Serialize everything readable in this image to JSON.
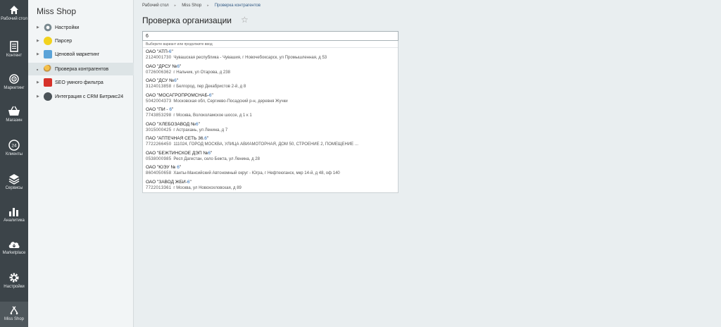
{
  "rail": [
    {
      "label": "Рабочий стол",
      "icon": "home-icon"
    },
    {
      "label": "Контент",
      "icon": "document-icon"
    },
    {
      "label": "Маркетинг",
      "icon": "target-icon"
    },
    {
      "label": "Магазин",
      "icon": "cart-icon"
    },
    {
      "label": "Клиенты",
      "icon": "clients-icon"
    },
    {
      "label": "Сервисы",
      "icon": "layers-icon"
    },
    {
      "label": "Аналитика",
      "icon": "bar-chart-icon"
    },
    {
      "label": "Marketplace",
      "icon": "cloud-download-icon"
    },
    {
      "label": "Настройки",
      "icon": "gear-icon"
    },
    {
      "label": "Miss Shop",
      "icon": "shop-icon"
    }
  ],
  "sidebar": {
    "title": "Miss Shop",
    "items": [
      {
        "label": "Настройки",
        "icon": "gear-icon"
      },
      {
        "label": "Парсер",
        "icon": "parser-icon"
      },
      {
        "label": "Ценовой маркетинг",
        "icon": "price-icon"
      },
      {
        "label": "Проверка контрагентов",
        "icon": "contractor-icon"
      },
      {
        "label": "SEO умного фильтра",
        "icon": "seo-icon"
      },
      {
        "label": "Интеграция с CRM Битрикс24",
        "icon": "crm-icon"
      }
    ]
  },
  "breadcrumbs": [
    "Рабочий стол",
    "Miss Shop",
    "Проверка контрагентов"
  ],
  "page": {
    "title": "Проверка организации"
  },
  "search": {
    "value": "6"
  },
  "dropdown": {
    "hint": "Выберите вариант или продолжите ввод",
    "options": [
      {
        "prefix": "ОАО \"АТП-",
        "hl": "6",
        "suffix": "\"",
        "inn": "2124001730",
        "address": "Чувашская республика - Чувашия, г Новочебоксарск, ул Промышленная, д 53"
      },
      {
        "prefix": "ОАО \"ДРСУ №",
        "hl": "6",
        "suffix": "\"",
        "inn": "0726006362",
        "address": "г Нальчик, ул Отарова, д 238"
      },
      {
        "prefix": "ОАО \"ДСУ №",
        "hl": "6",
        "suffix": "\"",
        "inn": "3124013858",
        "address": "г Белгород, пер Декабристов 2-й, д 8"
      },
      {
        "prefix": "ОАО \"МОСАГРОПРОМСНАБ-",
        "hl": "6",
        "suffix": "\"",
        "inn": "5042004373",
        "address": "Московская обл, Сергиево-Посадский р-н, деревня Жучки"
      },
      {
        "prefix": "ОАО \"ПИ - ",
        "hl": "6",
        "suffix": "\"",
        "inn": "7743853298",
        "address": "г Москва, Волоколамское шоссе, д 1 к 1"
      },
      {
        "prefix": "ОАО \"ХЛЕБОЗАВОД №",
        "hl": "6",
        "suffix": "\"",
        "inn": "3015000425",
        "address": "г Астрахань, ул Ленина, д 7"
      },
      {
        "prefix": "ПАО \"АПТЕЧНАЯ СЕТЬ 36.",
        "hl": "6",
        "suffix": "\"",
        "inn": "7722266450",
        "address": "111024, ГОРОД МОСКВА, УЛИЦА АВИАМОТОРНАЯ, ДОМ 50, СТРОЕНИЕ 2, ПОМЕЩЕНИЕ ..."
      },
      {
        "prefix": "ОАО \"БЕЖТИНСКОЕ ДЭП №",
        "hl": "6",
        "suffix": "\"",
        "inn": "0538000985",
        "address": "Респ Дагестан, село Бежта, ул Ленина, д 28"
      },
      {
        "prefix": "ОАО \"ЮЭУ № ",
        "hl": "6",
        "suffix": "\"",
        "inn": "8604050658",
        "address": "Ханты-Мансийский Автономный округ - Югра, г Нефтеюганск, мкр 14-й, д 48, оф 140"
      },
      {
        "prefix": "ОАО \"ЗАВОД ЖБИ-",
        "hl": "6",
        "suffix": "\"",
        "inn": "7722013361",
        "address": "г Москва, ул Новохохловская, д 89"
      }
    ]
  }
}
